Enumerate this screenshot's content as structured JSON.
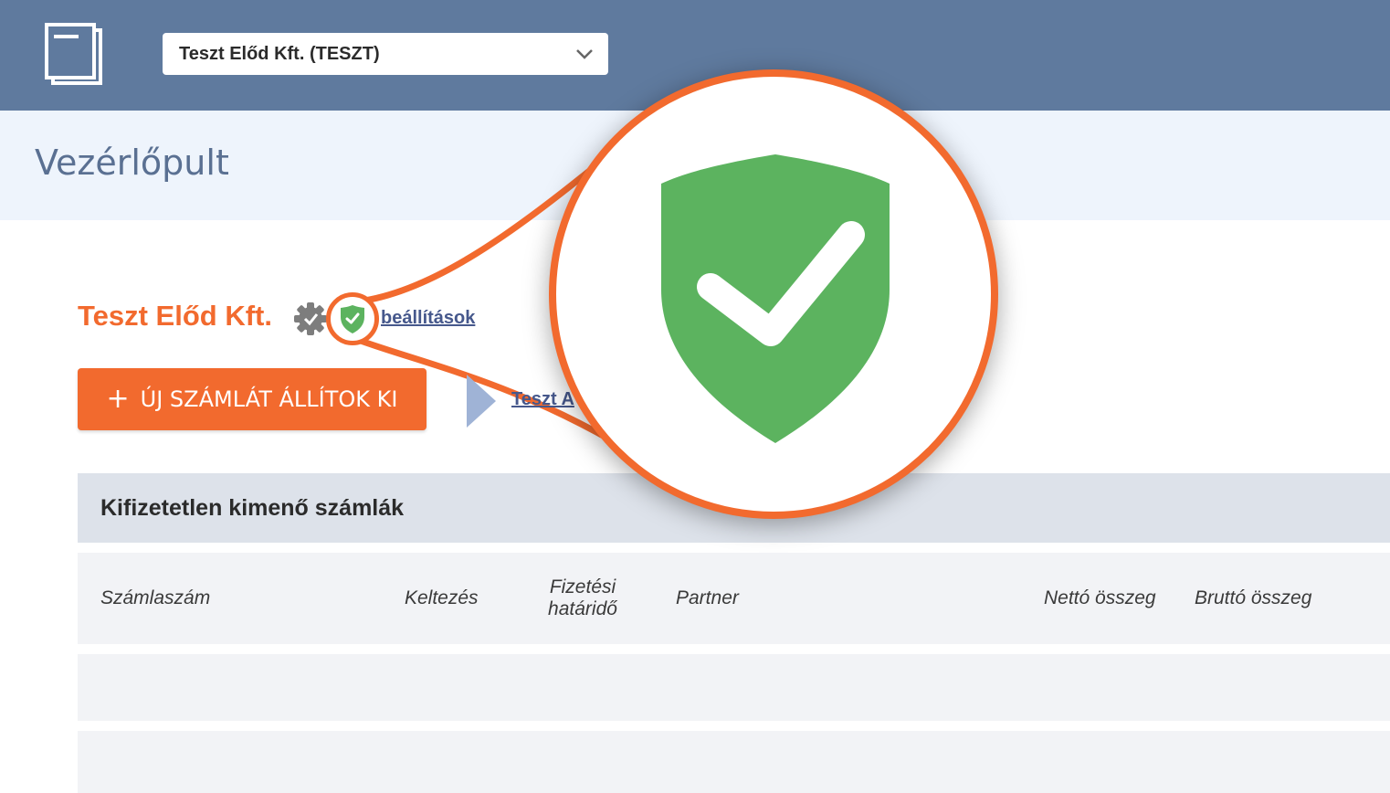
{
  "header": {
    "logo_icon": "document-stack-icon",
    "company_select": {
      "value": "Teszt Előd Kft. (TESZT)"
    }
  },
  "page": {
    "title": "Vezérlőpult"
  },
  "company": {
    "name": "Teszt Előd Kft.",
    "verified_icon": "gear-badge-icon",
    "security_icon": "shield-check-icon",
    "settings_link": "beállítások"
  },
  "actions": {
    "new_invoice_label": "ÚJ SZÁMLÁT ÁLLÍTOK KI",
    "partial_link": "Teszt A"
  },
  "unpaid_section": {
    "title": "Kifizetetlen kimenő számlák",
    "columns": [
      "Számlaszám",
      "Keltezés",
      "Fizetési határidő",
      "Partner",
      "Nettó összeg",
      "Bruttó összeg"
    ]
  },
  "colors": {
    "brand_orange": "#f26a2e",
    "header_blue": "#5f7a9e",
    "shield_green": "#5cb35f"
  }
}
